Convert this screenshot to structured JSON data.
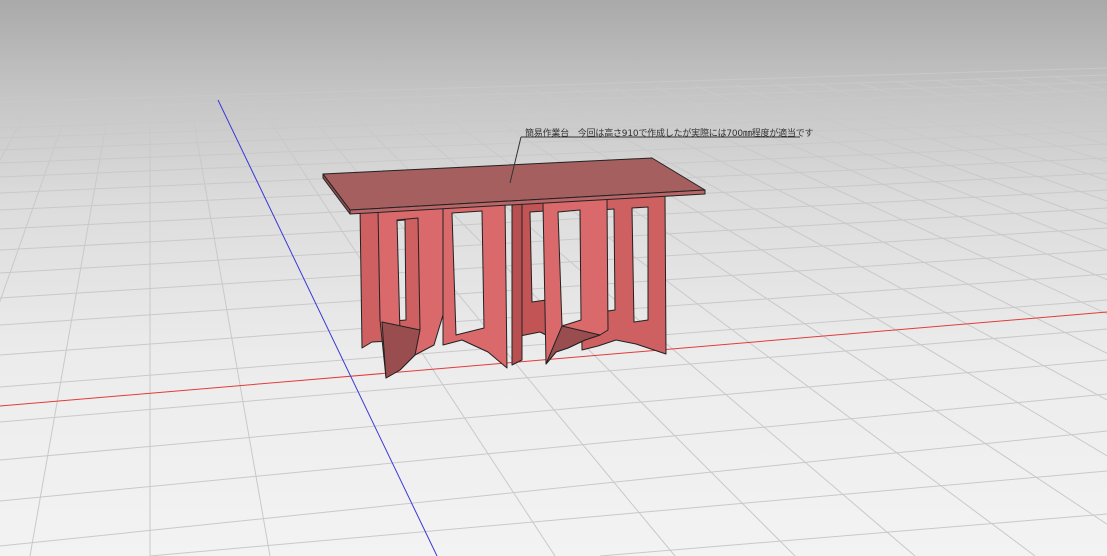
{
  "viewport": {
    "label": "3D modeling viewport",
    "background_top": "#a9a9a9",
    "background_bottom": "#f3f3f3",
    "grid_color": "#c7c7c7",
    "x_axis_color": "#e33b3b",
    "z_axis_color": "#3a3ad6"
  },
  "model": {
    "name": "simple workbench",
    "face_color": "#d9696b",
    "top_color": "#a55e5e",
    "edge_color": "#222222"
  },
  "annotation": {
    "text": "簡易作業台　今回は高さ910で作成したが実際には700㎜程度が適当です"
  }
}
